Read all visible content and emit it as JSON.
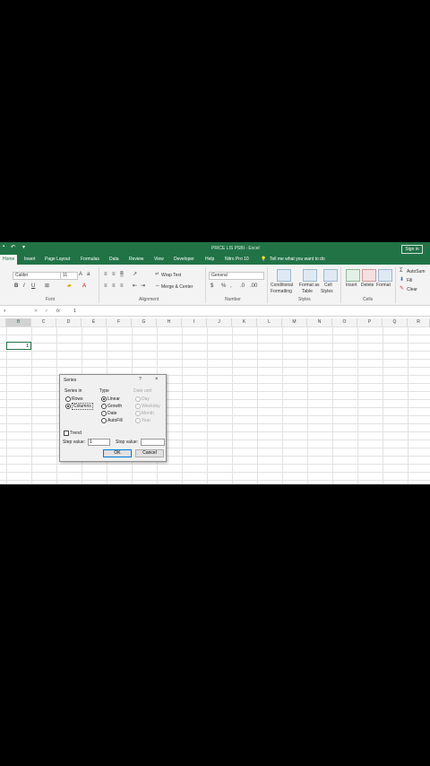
{
  "app": {
    "title": "PRICE LIS PSBI - Excel",
    "sign_in": "Sign in",
    "tell_me": "Tell me what you want to do"
  },
  "tabs": [
    "Home",
    "Insert",
    "Page Layout",
    "Formulas",
    "Data",
    "Review",
    "View",
    "Developer",
    "Help",
    "Nitro Pro 10"
  ],
  "ribbon": {
    "font_name": "Calibri",
    "font_size": "11",
    "wrap_text": "Wrap Text",
    "merge_center": "Merge & Center",
    "number_format": "General",
    "conditional_formatting": [
      "Conditional",
      "Formatting"
    ],
    "format_as_table": [
      "Format as",
      "Table"
    ],
    "cell_styles": [
      "Cell",
      "Styles"
    ],
    "insert": "Insert",
    "delete": "Delete",
    "format": "Format",
    "autosum": "AutoSum",
    "fill": "Fill",
    "clear": "Clear",
    "groups": {
      "font": "Font",
      "alignment": "Alignment",
      "number": "Number",
      "styles": "Styles",
      "cells": "Cells"
    }
  },
  "formula_bar": {
    "fx": "fx",
    "value": "1"
  },
  "columns": [
    "B",
    "C",
    "D",
    "E",
    "F",
    "G",
    "H",
    "I",
    "J",
    "K",
    "L",
    "M",
    "N",
    "O",
    "P",
    "Q",
    "R"
  ],
  "active_cell_value": "1",
  "dialog": {
    "title": "Series",
    "help": "?",
    "close": "×",
    "series_in_label": "Series in",
    "series_in": [
      "Rows",
      "Columns"
    ],
    "type_label": "Type",
    "types": [
      "Linear",
      "Growth",
      "Date",
      "AutoFill"
    ],
    "date_unit_label": "Date unit",
    "date_units": [
      "Day",
      "Weekday",
      "Month",
      "Year"
    ],
    "trend": "Trend",
    "step_value_label": "Step value:",
    "step_value": "1",
    "stop_value_label": "Stop value:",
    "stop_value": "",
    "ok": "OK",
    "cancel": "Cancel"
  }
}
